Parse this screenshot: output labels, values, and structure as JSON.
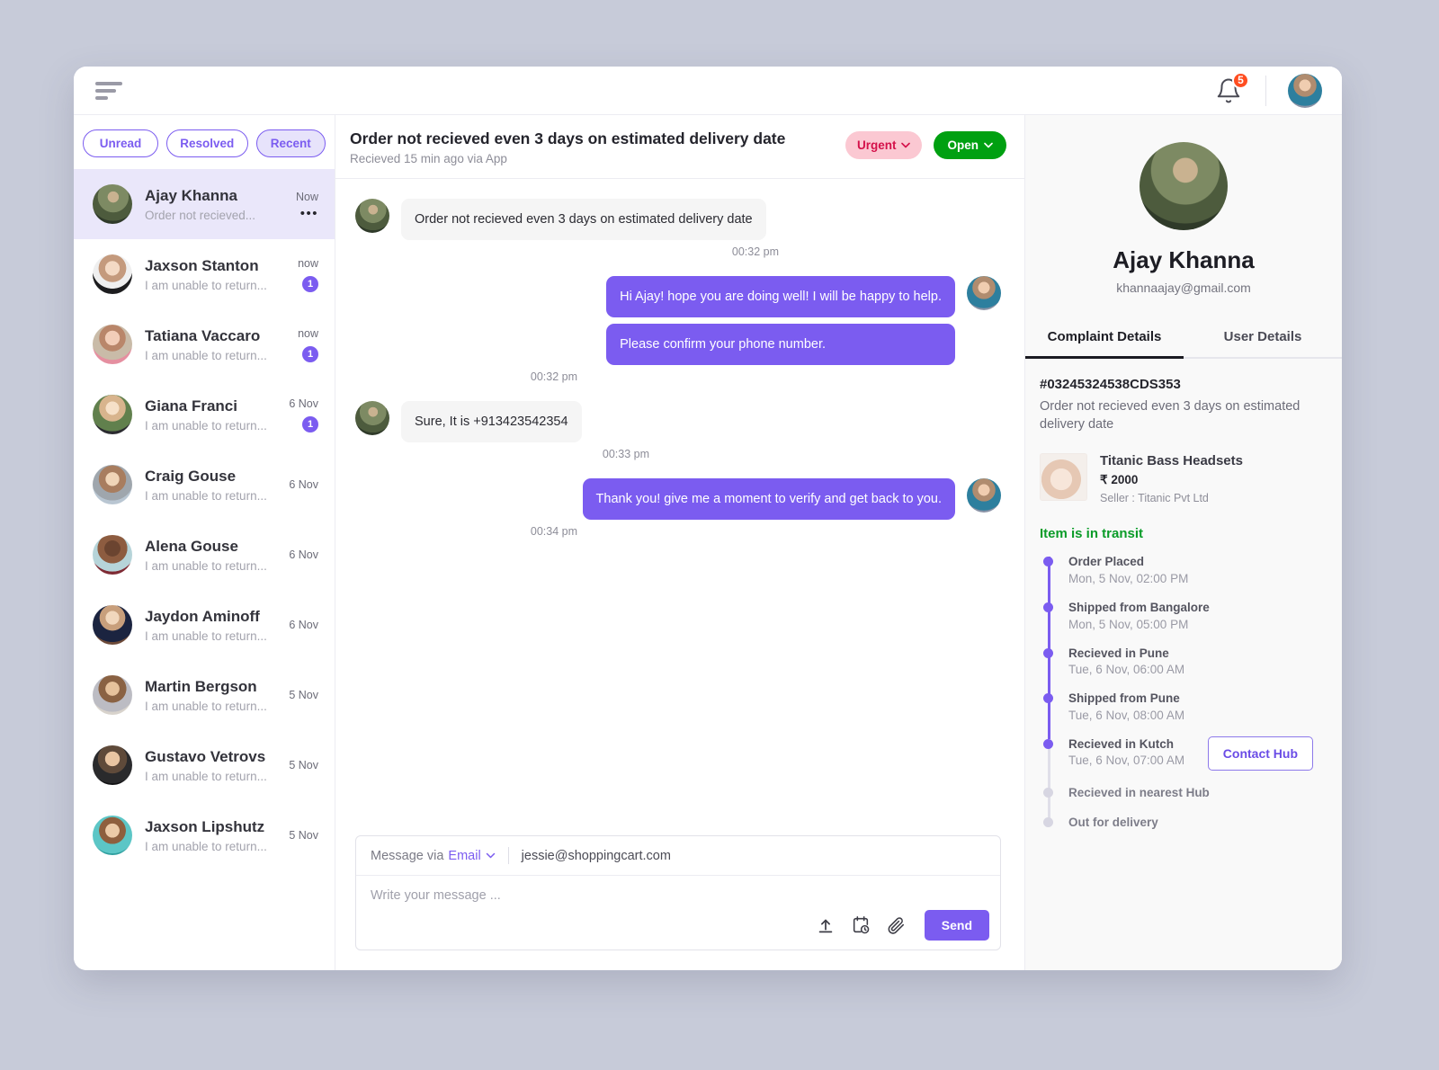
{
  "topbar": {
    "menu_icon": "hamburger-icon",
    "notification_icon": "bell-icon",
    "notification_count": "5",
    "account_avatar": "jessie-avatar"
  },
  "filters": [
    {
      "label": "Unread",
      "active": false
    },
    {
      "label": "Resolved",
      "active": false
    },
    {
      "label": "Recent",
      "active": true
    }
  ],
  "threads": [
    {
      "name": "Ajay Khanna",
      "preview": "Order not recieved...",
      "time": "Now",
      "badge": "",
      "menu": "•••",
      "selected": true,
      "avatar": "av-ajay"
    },
    {
      "name": "Jaxson Stanton",
      "preview": "I am unable to return...",
      "time": "now",
      "badge": "1",
      "selected": false,
      "avatar": "av-1"
    },
    {
      "name": "Tatiana Vaccaro",
      "preview": "I am unable to return...",
      "time": "now",
      "badge": "1",
      "selected": false,
      "avatar": "av-2"
    },
    {
      "name": "Giana Franci",
      "preview": "I am unable to return...",
      "time": "6 Nov",
      "badge": "1",
      "selected": false,
      "avatar": "av-3"
    },
    {
      "name": "Craig Gouse",
      "preview": "I am unable to return...",
      "time": "6 Nov",
      "badge": "",
      "selected": false,
      "avatar": "av-4"
    },
    {
      "name": "Alena Gouse",
      "preview": "I am unable to return...",
      "time": "6 Nov",
      "badge": "",
      "selected": false,
      "avatar": "av-5"
    },
    {
      "name": "Jaydon Aminoff",
      "preview": "I am unable to return...",
      "time": "6 Nov",
      "badge": "",
      "selected": false,
      "avatar": "av-6"
    },
    {
      "name": "Martin Bergson",
      "preview": "I am unable to return...",
      "time": "5 Nov",
      "badge": "",
      "selected": false,
      "avatar": "av-7"
    },
    {
      "name": "Gustavo Vetrovs",
      "preview": "I am unable to return...",
      "time": "5 Nov",
      "badge": "",
      "selected": false,
      "avatar": "av-8"
    },
    {
      "name": "Jaxson Lipshutz",
      "preview": "I am unable to return...",
      "time": "5 Nov",
      "badge": "",
      "selected": false,
      "avatar": "av-9"
    }
  ],
  "conversation": {
    "title": "Order not recieved even 3 days on estimated delivery date",
    "subtitle": "Recieved 15 min ago via App",
    "priority_label": "Urgent",
    "status_label": "Open",
    "messages": [
      {
        "direction": "in",
        "avatar": "av-ajay",
        "bubbles": [
          "Order not recieved even 3 days on estimated delivery date"
        ],
        "time": "00:32 pm"
      },
      {
        "direction": "out",
        "avatar": "av-jessie",
        "bubbles": [
          "Hi Ajay! hope you are doing well! I will be happy to help.",
          "Please confirm your phone number."
        ],
        "time": "00:32 pm"
      },
      {
        "direction": "in",
        "avatar": "av-ajay",
        "bubbles": [
          "Sure, It is +913423542354"
        ],
        "time": "00:33 pm"
      },
      {
        "direction": "out",
        "avatar": "av-jessie",
        "bubbles": [
          "Thank you! give me a moment to verify and get back to you."
        ],
        "time": "00:34 pm"
      }
    ]
  },
  "composer": {
    "channel_prefix": "Message via",
    "channel": "Email",
    "recipient": "jessie@shoppingcart.com",
    "placeholder": "Write your message ...",
    "upload_icon": "upload-icon",
    "schedule_icon": "schedule-clock-icon",
    "attach_icon": "paperclip-icon",
    "send_label": "Send"
  },
  "profile": {
    "name": "Ajay Khanna",
    "email": "khannaajay@gmail.com",
    "avatar": "av-ajay",
    "tabs": [
      {
        "label": "Complaint Details",
        "active": true
      },
      {
        "label": "User Details",
        "active": false
      }
    ]
  },
  "complaint": {
    "order_id": "#03245324538CDS353",
    "description": "Order not recieved even 3 days on estimated delivery date",
    "product": {
      "name": "Titanic Bass Headsets",
      "price": "₹ 2000",
      "seller": "Seller : Titanic Pvt Ltd"
    },
    "transit_status": "Item is in transit",
    "contact_button": "Contact Hub",
    "timeline": [
      {
        "label": "Order Placed",
        "time": "Mon, 5 Nov, 02:00 PM",
        "done": true
      },
      {
        "label": "Shipped from Bangalore",
        "time": "Mon, 5 Nov, 05:00 PM",
        "done": true
      },
      {
        "label": "Recieved in Pune",
        "time": "Tue, 6 Nov, 06:00 AM",
        "done": true
      },
      {
        "label": "Shipped from Pune",
        "time": "Tue, 6 Nov, 08:00 AM",
        "done": true
      },
      {
        "label": "Recieved in Kutch",
        "time": "Tue, 6 Nov, 07:00 AM",
        "done": true
      },
      {
        "label": "Recieved in nearest Hub",
        "time": "",
        "done": false
      },
      {
        "label": "Out for delivery",
        "time": "",
        "done": false
      }
    ]
  },
  "colors": {
    "accent": "#7b5cf0",
    "urgent_bg": "#fbc8d2",
    "urgent_text": "#d4114a",
    "open_bg": "#00a011",
    "transit_green": "#0a9c28",
    "notification_red": "#ff4d20",
    "page_bg": "#c7cbd9"
  }
}
